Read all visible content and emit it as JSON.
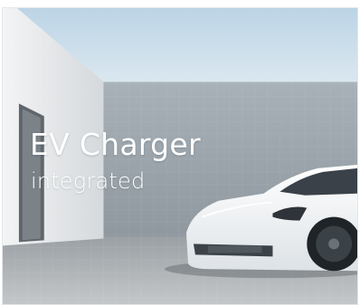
{
  "card": {
    "title": "EV Charger",
    "subtitle": "integrated",
    "image": "car-garage-photo"
  },
  "colors": {
    "sky": "#c9dcea",
    "wall": "#e9ecee",
    "back_wall": "#9fa7ad",
    "floor": "#b8bcbf",
    "car": "#f4f6f8",
    "text": "#ffffff"
  }
}
